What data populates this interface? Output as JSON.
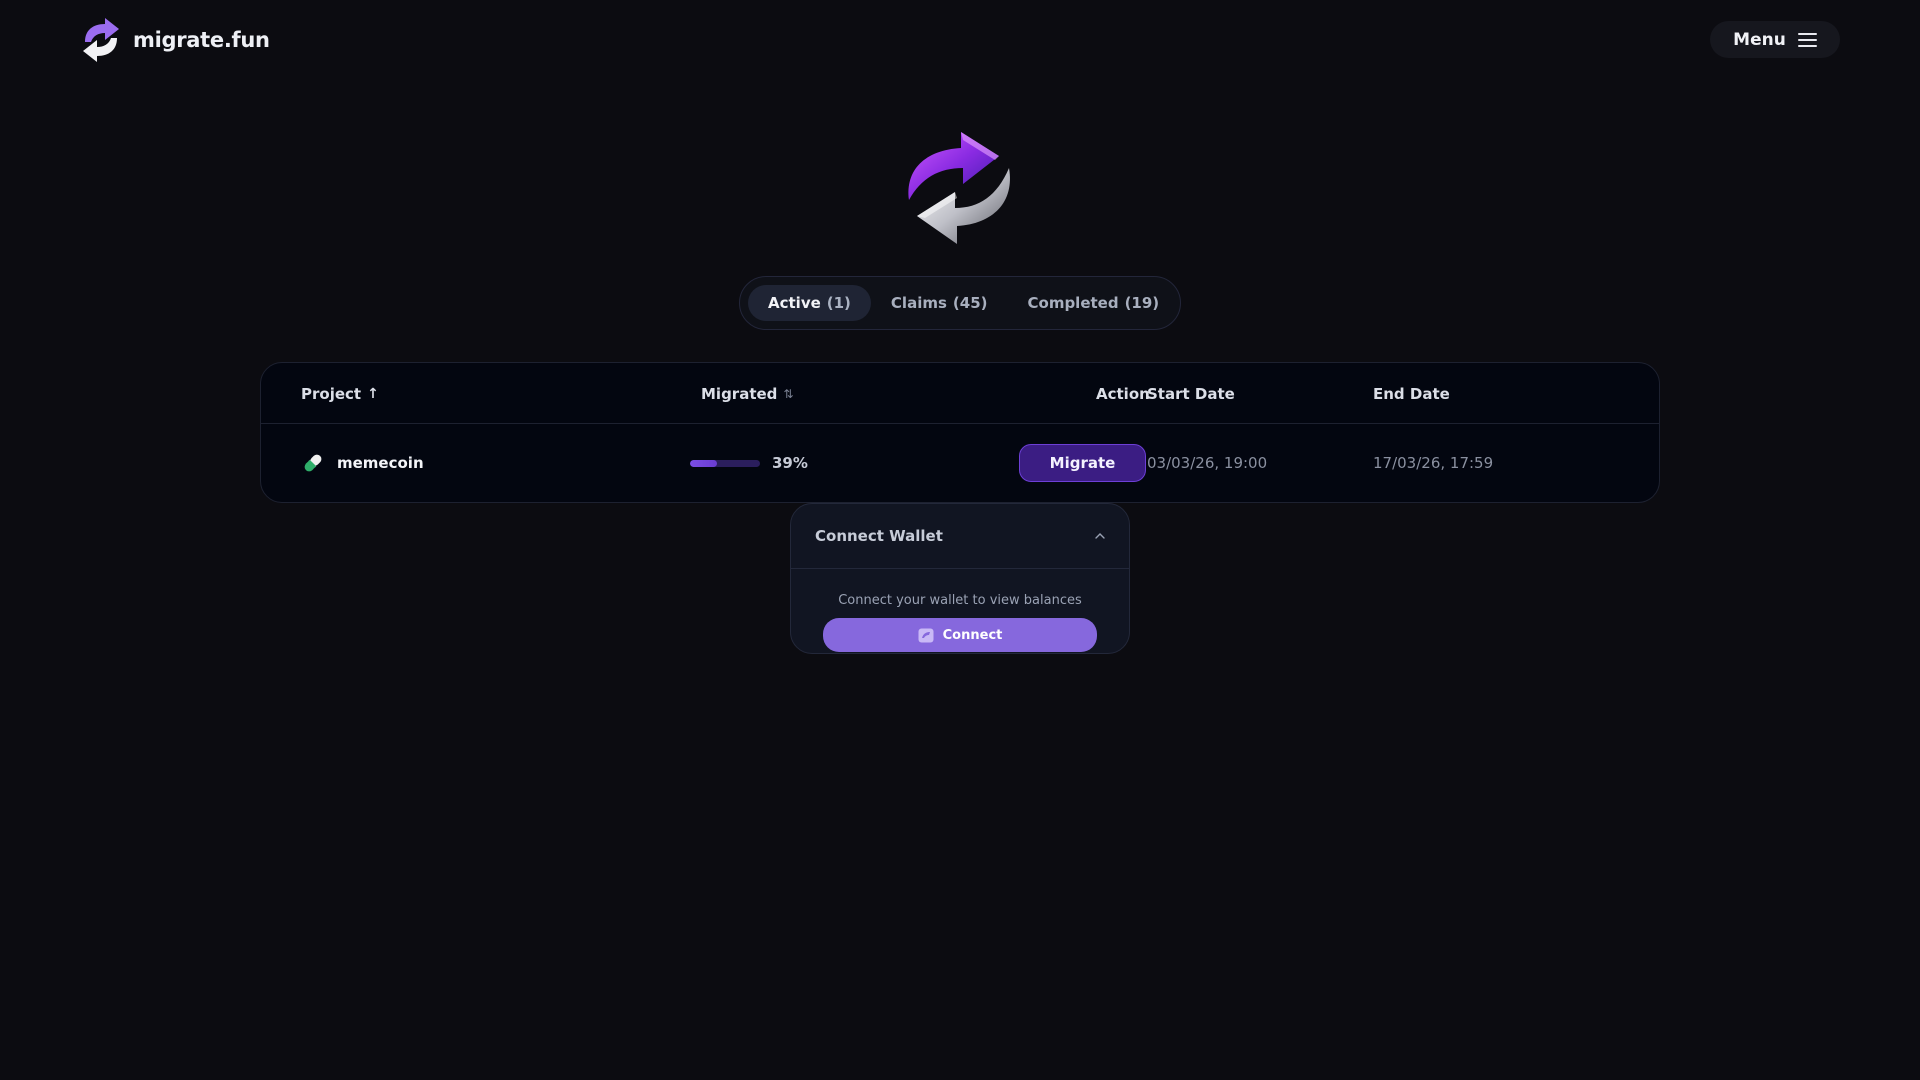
{
  "header": {
    "brand": "migrate.fun",
    "menu_label": "Menu"
  },
  "tabs": [
    {
      "label": "Active",
      "count": "(1)",
      "active": true
    },
    {
      "label": "Claims",
      "count": "(45)",
      "active": false
    },
    {
      "label": "Completed",
      "count": "(19)",
      "active": false
    }
  ],
  "table": {
    "columns": {
      "project": "Project",
      "project_sort": "↑",
      "migrated": "Migrated",
      "migrated_sort": "⇅",
      "action": "Action",
      "start_date": "Start Date",
      "end_date": "End Date"
    },
    "rows": [
      {
        "project": "memecoin",
        "migrated_fraction": 0.39,
        "migrated_label": "39%",
        "action_label": "Migrate",
        "start_date": "03/03/26, 19:00",
        "end_date": "17/03/26, 17:59"
      }
    ]
  },
  "wallet": {
    "title": "Connect Wallet",
    "message": "Connect your wallet to view balances",
    "connect_label": "Connect"
  },
  "colors": {
    "background": "#0c0c11",
    "accent": "#8668dd",
    "migrate_button": "#3b1d83",
    "progress_fill": "#7b4de4"
  },
  "icons": {
    "logo": "swap-arrows-icon",
    "menu": "hamburger-icon",
    "project": "pill-icon",
    "wallet_toggle": "chevron-up-icon",
    "connect": "wallet-icon"
  }
}
